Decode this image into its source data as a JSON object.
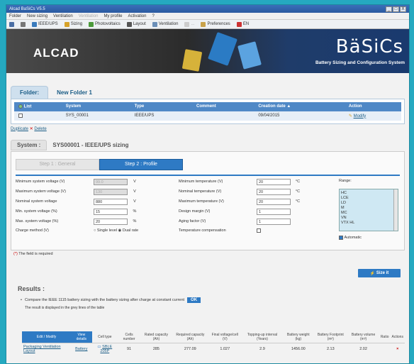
{
  "window": {
    "title": "Alcad BaSiCs V5.5",
    "controls": [
      "_",
      "□",
      "X"
    ]
  },
  "menu": [
    "Folder",
    "New sizing",
    "Ventilation",
    "Ventilation",
    "My profile",
    "Activation",
    "?"
  ],
  "menu_disabled": [
    3
  ],
  "toolbar": {
    "items": [
      {
        "icon": "save-icon",
        "label": ""
      },
      {
        "icon": "grid-icon",
        "label": ""
      },
      {
        "icon": "ieee-icon",
        "label": "IEEE/UPS"
      },
      {
        "icon": "sizing-icon",
        "label": "Sizing"
      },
      {
        "icon": "photo-icon",
        "label": "Photovoltaics"
      },
      {
        "icon": "layout-icon",
        "label": "Layout"
      },
      {
        "icon": "ventilation-icon",
        "label": "Ventilation"
      },
      {
        "icon": "disabled-icon",
        "label": "..."
      },
      {
        "icon": "preferences-icon",
        "label": "Preferences"
      },
      {
        "icon": "lang-icon",
        "label": "EN"
      }
    ]
  },
  "banner": {
    "logo": "ALCAD",
    "brand": "BäSiCs",
    "tagline": "Battery Sizing and Configuration System"
  },
  "folder": {
    "tab_label": "Folder:",
    "name": "New Folder 1",
    "columns": [
      "List",
      "System",
      "Type",
      "Comment",
      "Creation date",
      "Action"
    ],
    "rows": [
      {
        "system": "SYS_00001",
        "type": "IEEE/UPS",
        "comment": "",
        "date": "09/04/2015",
        "action": "Modify"
      }
    ],
    "actions": [
      "Duplicate",
      "Delete"
    ]
  },
  "system": {
    "label": "System :",
    "name": "SYS00001 - IEEE/UPS sizing"
  },
  "steps": [
    "Step 1 : General",
    "Step 2 : Profile"
  ],
  "form_left": [
    {
      "label": "Minimum system voltage (V)",
      "value": "99.0",
      "unit": "V",
      "disabled": true
    },
    {
      "label": "Maximum system voltage (V)",
      "value": "130",
      "unit": "V",
      "disabled": true
    },
    {
      "label": "Nominal system voltage",
      "value": "880",
      "unit": "V",
      "disabled": false
    },
    {
      "label": "Min. system voltage (%)",
      "value": "15",
      "unit": "%",
      "disabled": false
    },
    {
      "label": "Max. system voltage (%)",
      "value": "20",
      "unit": "%",
      "disabled": false
    },
    {
      "label": "Charge method (V)",
      "value": "",
      "unit": "",
      "disabled": false
    }
  ],
  "charge_options": [
    "Single level",
    "Dual rate"
  ],
  "form_right": [
    {
      "label": "Minimum temperature (V)",
      "value": "20",
      "unit": "°C"
    },
    {
      "label": "Nominal temperature (V)",
      "value": "20",
      "unit": "°C"
    },
    {
      "label": "Maximum temperature (V)",
      "value": "20",
      "unit": "°C"
    },
    {
      "label": "Design margin (V)",
      "value": "1",
      "unit": ""
    },
    {
      "label": "Aging factor (V)",
      "value": "1",
      "unit": ""
    },
    {
      "label": "Temperature compensation",
      "value": "",
      "unit": ""
    }
  ],
  "range": {
    "label": "Range:",
    "items": [
      "HC",
      "LCE",
      "LD",
      "M",
      "MC",
      "VN",
      "VTX HL"
    ],
    "auto_label": "Automatic"
  },
  "required_note": "The field is required",
  "save_label": "Size it",
  "results": {
    "title": "Results :",
    "compare_text": "Compare the IEEE 1115 battery sizing with the battery sizing after charge at constant current",
    "ok_label": "OK",
    "note": "The result is displayed in the grey lines of the table",
    "columns": [
      "Edit / Modify",
      "View details",
      "Cell type",
      "Cells number",
      "Rated capacity (Ah)",
      "Required capacity (Ah)",
      "Final voltage/cell (V)",
      "Topping-up interval (Years)",
      "Battery weight (kg)",
      "Battery Footprint (m²)",
      "Battery volume (m³)",
      "Ratio",
      "Actions"
    ],
    "rows": [
      {
        "edit": "Packaging Ventilation Layout",
        "view": "Battery",
        "cell": "SBLE 205P",
        "cells": "91",
        "rated": "285",
        "required": "277.09",
        "final": "1.027",
        "topping": "2.9",
        "weight": "1456.00",
        "footprint": "2.13",
        "volume": "2.02",
        "ratio": "",
        "action": "×"
      }
    ]
  }
}
